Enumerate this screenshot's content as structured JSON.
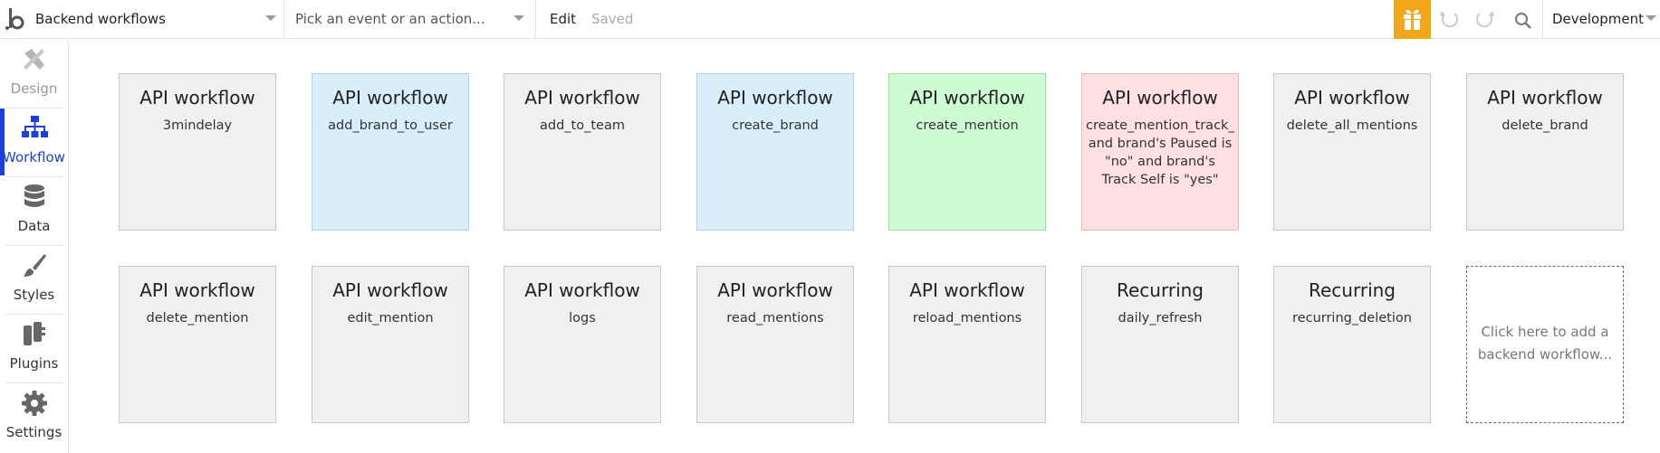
{
  "header": {
    "page_select_value": "Backend workflows",
    "event_select_placeholder": "Pick an event or an action...",
    "edit_label": "Edit",
    "saved_label": "Saved",
    "environment_value": "Development",
    "accent_color": "#f4a61b"
  },
  "sidebar": {
    "items": [
      {
        "label": "Design",
        "icon": "design-icon",
        "state": "disabled"
      },
      {
        "label": "Workflow",
        "icon": "workflow-icon",
        "state": "active"
      },
      {
        "label": "Data",
        "icon": "data-icon",
        "state": "normal"
      },
      {
        "label": "Styles",
        "icon": "styles-icon",
        "state": "normal"
      },
      {
        "label": "Plugins",
        "icon": "plugins-icon",
        "state": "normal"
      },
      {
        "label": "Settings",
        "icon": "settings-icon",
        "state": "normal"
      }
    ],
    "active_color": "#1a3fdc"
  },
  "workflows": [
    {
      "type": "API workflow",
      "name": "3mindelay",
      "color": "gray"
    },
    {
      "type": "API workflow",
      "name": "add_brand_to_user",
      "color": "blue"
    },
    {
      "type": "API workflow",
      "name": "add_to_team",
      "color": "gray"
    },
    {
      "type": "API workflow",
      "name": "create_brand",
      "color": "blue"
    },
    {
      "type": "API workflow",
      "name": "create_mention",
      "color": "green"
    },
    {
      "type": "API workflow",
      "name": "create_mention_track_se",
      "condition": "and brand's Paused is \"no\" and brand's Track Self is \"yes\"",
      "color": "red"
    },
    {
      "type": "API workflow",
      "name": "delete_all_mentions",
      "color": "gray"
    },
    {
      "type": "API workflow",
      "name": "delete_brand",
      "color": "gray"
    },
    {
      "type": "API workflow",
      "name": "delete_mention",
      "color": "gray"
    },
    {
      "type": "API workflow",
      "name": "edit_mention",
      "color": "gray"
    },
    {
      "type": "API workflow",
      "name": "logs",
      "color": "gray"
    },
    {
      "type": "API workflow",
      "name": "read_mentions",
      "color": "gray"
    },
    {
      "type": "API workflow",
      "name": "reload_mentions",
      "color": "gray"
    },
    {
      "type": "Recurring",
      "name": "daily_refresh",
      "color": "gray"
    },
    {
      "type": "Recurring",
      "name": "recurring_deletion",
      "color": "gray"
    }
  ],
  "add_card": {
    "label": "Click here to add a backend workflow..."
  }
}
